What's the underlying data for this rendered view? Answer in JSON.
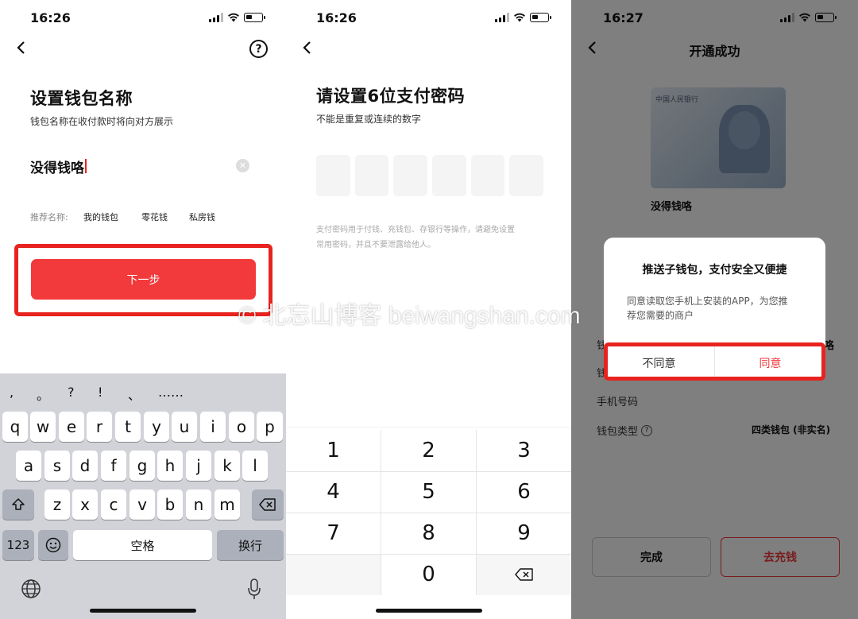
{
  "screen1": {
    "time": "16:26",
    "title": "设置钱包名称",
    "subtitle": "钱包名称在收付款时将向对方展示",
    "wallet_name_value": "没得钱咯",
    "suggest_label": "推荐名称:",
    "suggestions": [
      "我的钱包",
      "零花钱",
      "私房钱"
    ],
    "next_button": "下一步",
    "keyboard": {
      "symbols": [
        ",",
        "。",
        "?",
        "!",
        "、",
        "……"
      ],
      "row1": [
        "q",
        "w",
        "e",
        "r",
        "t",
        "y",
        "u",
        "i",
        "o",
        "p"
      ],
      "row2": [
        "a",
        "s",
        "d",
        "f",
        "g",
        "h",
        "j",
        "k",
        "l"
      ],
      "row3": [
        "z",
        "x",
        "c",
        "v",
        "b",
        "n",
        "m"
      ],
      "num_key": "123",
      "space_key": "空格",
      "return_key": "换行"
    }
  },
  "screen2": {
    "time": "16:26",
    "title": "请设置6位支付密码",
    "subtitle": "不能是重复或连续的数字",
    "hint_line1": "支付密码用于付钱、充钱包、存银行等操作，请避免设置",
    "hint_line2": "常用密码，并且不要泄露给他人。",
    "numpad": [
      "1",
      "2",
      "3",
      "4",
      "5",
      "6",
      "7",
      "8",
      "9",
      "0"
    ]
  },
  "screen3": {
    "time": "16:27",
    "nav_title": "开通成功",
    "bank_name": "中国人民银行",
    "wallet_name": "没得钱咯",
    "rows": {
      "row1_label": "钱",
      "row1_value": "咯",
      "row2_label": "钱",
      "phone_label": "手机号码",
      "type_label": "钱包类型",
      "type_value": "四类钱包 (非实名)"
    },
    "done_button": "完成",
    "recharge_button": "去充钱",
    "dialog": {
      "title": "推送子钱包，支付安全又便捷",
      "body_line1": "同意读取您手机上安装的APP，为您推",
      "body_line2": "荐您需要的商户",
      "disagree": "不同意",
      "agree": "同意"
    }
  },
  "watermark": "© 北忘山博客 beiwangshan.com",
  "colors": {
    "accent": "#f2393b",
    "highlight": "#e8231f"
  }
}
